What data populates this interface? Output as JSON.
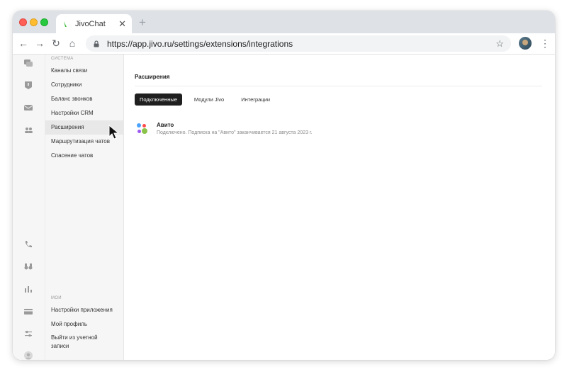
{
  "browser": {
    "tab_title": "JivoChat",
    "url": "https://app.jivo.ru/settings/extensions/integrations"
  },
  "sidebar": {
    "section_system": "СИСТЕМА",
    "items": [
      {
        "label": "Каналы связи"
      },
      {
        "label": "Сотрудники"
      },
      {
        "label": "Баланс звонков"
      },
      {
        "label": "Настройки CRM"
      },
      {
        "label": "Расширения",
        "active": true
      },
      {
        "label": "Маршрутизация чатов"
      },
      {
        "label": "Спасение чатов"
      }
    ],
    "section_mine": "МОИ",
    "bottom_items": [
      {
        "label": "Настройки приложения"
      },
      {
        "label": "Мой профиль"
      },
      {
        "label": "Выйти из учетной записи"
      }
    ]
  },
  "main": {
    "title": "Расширения",
    "tabs": [
      {
        "label": "Подключенные",
        "active": true
      },
      {
        "label": "Модули Jivo"
      },
      {
        "label": "Интеграции"
      }
    ],
    "extension": {
      "name": "Авито",
      "status": "Подключено. Подписка на \"Авито\" заканчивается 21 августа 2023 г."
    }
  },
  "icons": {
    "rail": [
      "chats-icon",
      "alert-icon",
      "mail-icon",
      "team-icon",
      "phone-icon",
      "binoculars-icon",
      "stats-icon",
      "card-icon",
      "settings-sliders-icon",
      "user-avatar-icon"
    ]
  },
  "colors": {
    "active_tab": "#1f1f1f",
    "sidebar_bg": "#f6f6f6",
    "active_item": "#e8e8e8"
  }
}
